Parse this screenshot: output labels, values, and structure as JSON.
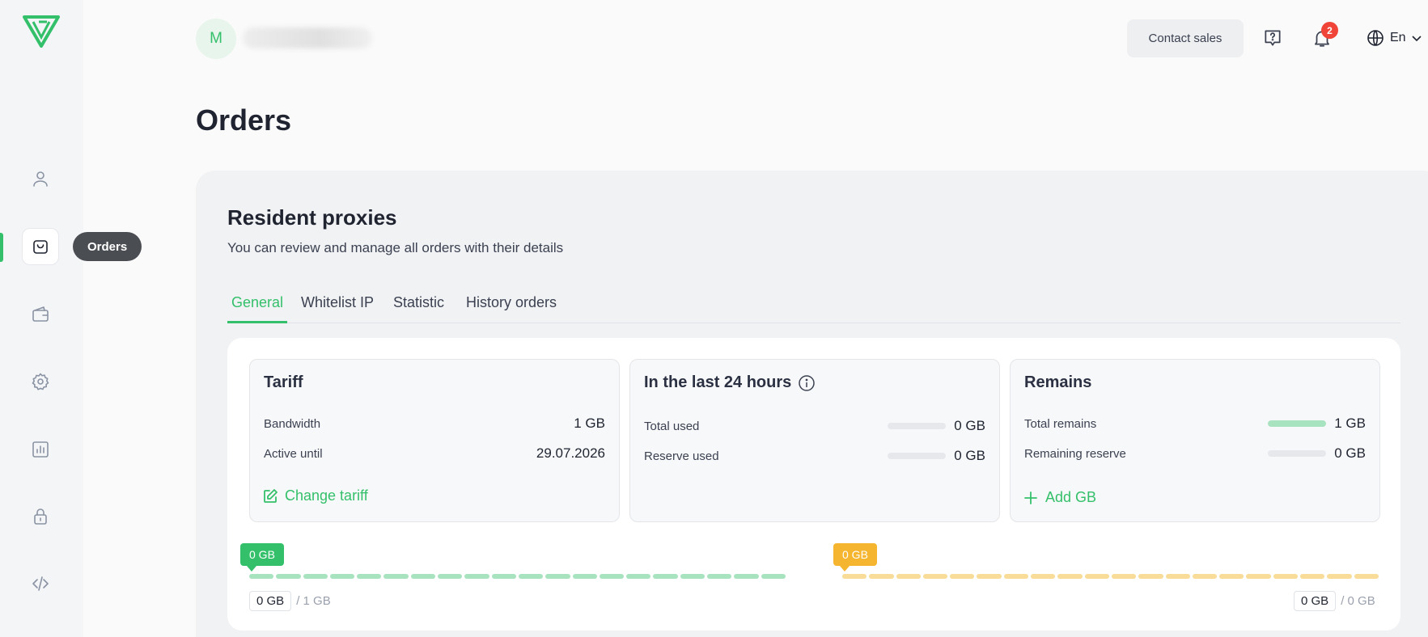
{
  "sidebar": {
    "items": [
      {
        "name": "profile",
        "icon": "user-icon"
      },
      {
        "name": "orders",
        "icon": "shopping-bag-icon"
      },
      {
        "name": "wallet",
        "icon": "wallet-icon"
      },
      {
        "name": "settings",
        "icon": "gear-icon"
      },
      {
        "name": "statistics",
        "icon": "bar-chart-icon"
      },
      {
        "name": "security",
        "icon": "lock-icon"
      },
      {
        "name": "api",
        "icon": "code-icon"
      }
    ],
    "tooltip": "Orders",
    "accent": "#34c06b"
  },
  "header": {
    "avatar_letter": "M",
    "contact_sales": "Contact sales",
    "notification_count": "2",
    "language": "En"
  },
  "page": {
    "title": "Orders"
  },
  "section": {
    "title": "Resident proxies",
    "subtitle": "You can review and manage all orders with their details"
  },
  "tabs": [
    {
      "label": "General",
      "active": true
    },
    {
      "label": "Whitelist IP",
      "active": false
    },
    {
      "label": "Statistic",
      "active": false
    },
    {
      "label": "History orders",
      "active": false
    }
  ],
  "tariff": {
    "title": "Tariff",
    "bandwidth_label": "Bandwidth",
    "bandwidth_value": "1 GB",
    "active_until_label": "Active until",
    "active_until_value": "29.07.2026",
    "action": "Change tariff"
  },
  "last24": {
    "title": "In the last 24 hours",
    "total_used_label": "Total used",
    "total_used_value": "0 GB",
    "total_used_fraction": 0,
    "reserve_used_label": "Reserve used",
    "reserve_used_value": "0 GB",
    "reserve_used_fraction": 0
  },
  "remains": {
    "title": "Remains",
    "total_remains_label": "Total remains",
    "total_remains_value": "1 GB",
    "total_remains_fraction": 1,
    "remaining_reserve_label": "Remaining reserve",
    "remaining_reserve_value": "0 GB",
    "remaining_reserve_fraction": 0,
    "action": "Add GB"
  },
  "meters": {
    "main": {
      "flag": "0 GB",
      "used": "0 GB",
      "total": "/ 1 GB",
      "color": "#34c06b"
    },
    "reserve": {
      "flag": "0 GB",
      "used": "0 GB",
      "total": "/ 0 GB",
      "color": "#f5b52e"
    }
  }
}
